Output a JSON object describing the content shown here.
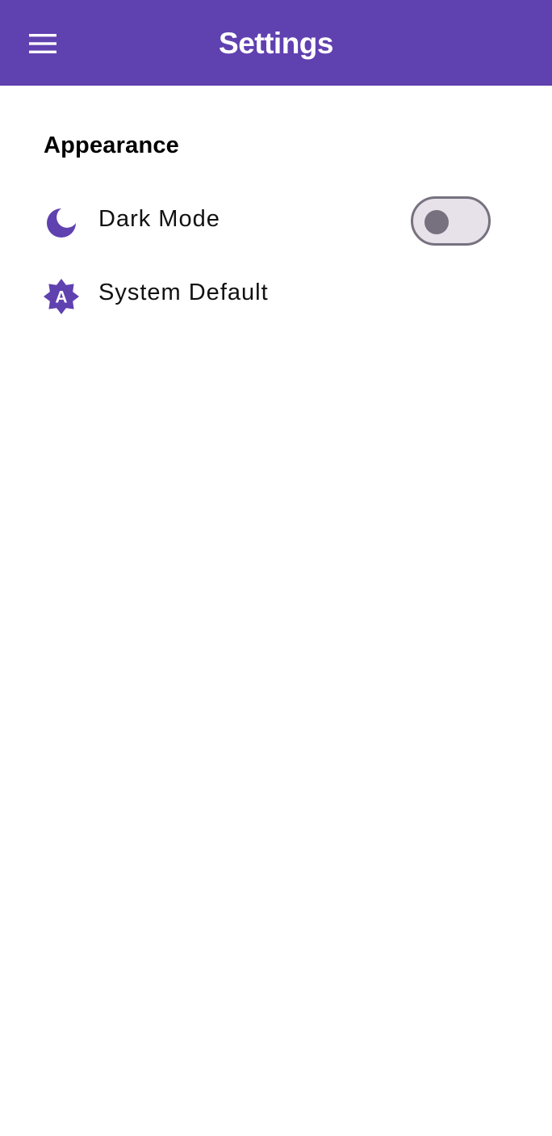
{
  "app_bar": {
    "title": "Settings",
    "menu_icon": "hamburger-menu-icon",
    "background_color": "#6041b0",
    "text_color": "#ffffff"
  },
  "section": {
    "title": "Appearance"
  },
  "settings": {
    "dark_mode": {
      "label": "Dark Mode",
      "icon": "moon-icon",
      "toggle_on": false
    },
    "system_default": {
      "label": "System Default",
      "icon": "auto-brightness-icon",
      "icon_letter": "A"
    }
  },
  "colors": {
    "accent": "#6041b0",
    "toggle_track": "#e7e1ea",
    "toggle_outline": "#77717f"
  }
}
